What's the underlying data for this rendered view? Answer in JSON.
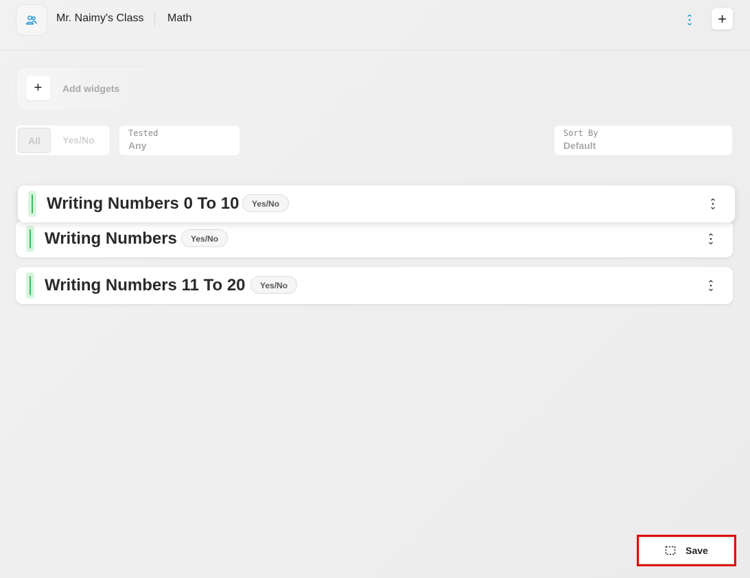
{
  "header": {
    "class_name": "Mr. Naimy's Class",
    "subject": "Math",
    "add_label": "+"
  },
  "widgets": {
    "plus_label": "+",
    "label": "Add widgets"
  },
  "filters": {
    "segments": [
      "All",
      "Yes/No"
    ],
    "tested": {
      "label": "Tested",
      "value": "Any"
    },
    "sort": {
      "label": "Sort By",
      "value": "Default"
    }
  },
  "items": [
    {
      "title": "Writing Numbers 0 To 10",
      "badge": "Yes/No"
    },
    {
      "title": "Writing Numbers",
      "badge": "Yes/No"
    },
    {
      "title": "Writing Numbers 11 To 20",
      "badge": "Yes/No"
    }
  ],
  "save": {
    "label": "Save"
  },
  "colors": {
    "accent_blue": "#1a8fd6",
    "status_green": "#3dbb5c",
    "highlight_red": "#e00000"
  },
  "icons": {
    "class": "people-icon",
    "header_menu": "vertical-dots-icon",
    "item_menu": "vertical-dots-icon",
    "save": "selection-icon"
  }
}
